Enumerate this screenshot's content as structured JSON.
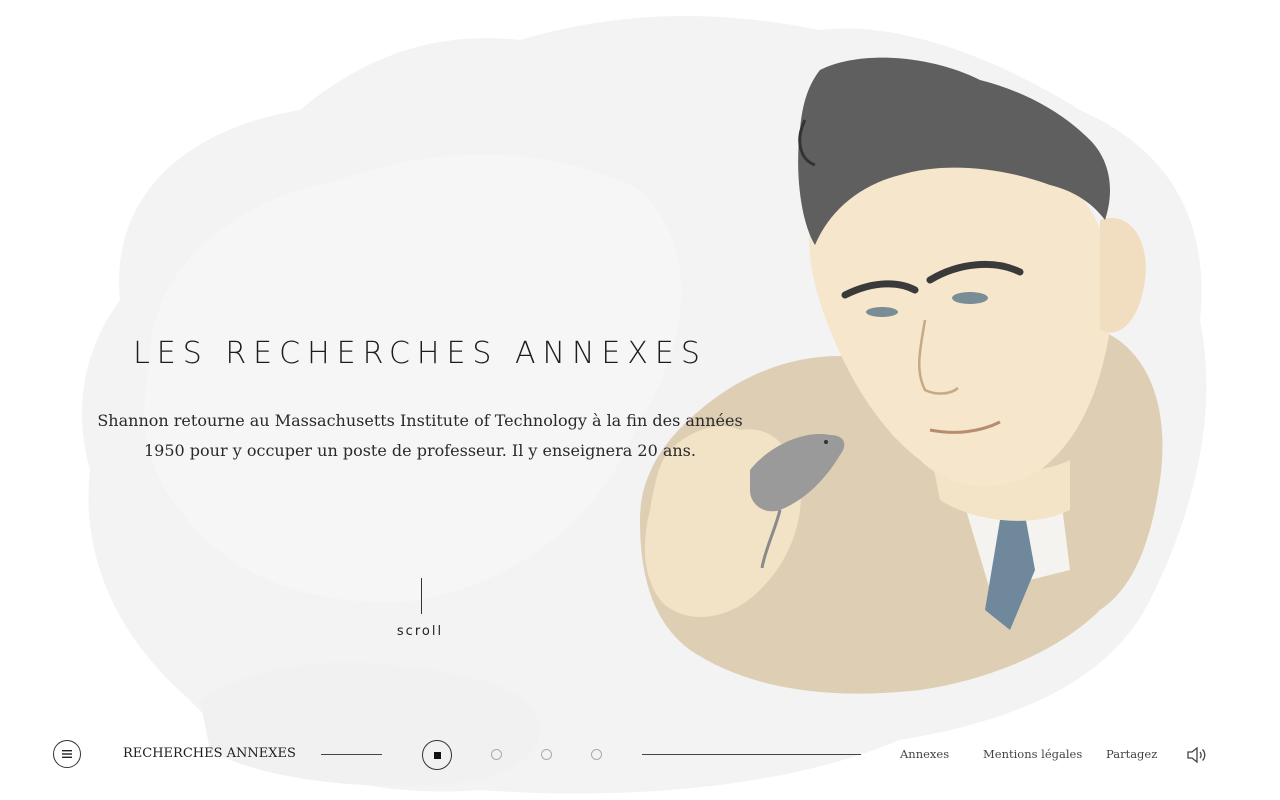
{
  "hero": {
    "title": "LES RECHERCHES ANNEXES",
    "text": "Shannon retourne au Massachusetts Institute of Technology à la fin des années 1950 pour y occuper un poste de professeur. Il y enseignera 20 ans.",
    "scroll_label": "scroll"
  },
  "portrait": {
    "subject": "illustrated portrait of a man holding a mouse"
  },
  "footer": {
    "menu_icon": "menu-icon",
    "section_label": "RECHERCHES ANNEXES",
    "steps": {
      "count": 4,
      "active_index": 0
    },
    "links": [
      {
        "label": "Annexes"
      },
      {
        "label": "Mentions légales"
      },
      {
        "label": "Partagez"
      }
    ],
    "sound_icon": "speaker-icon"
  },
  "colors": {
    "wash": "#f3f3f3",
    "text": "#222222",
    "hair": "#5e5e5e",
    "skin": "#f6e6cb",
    "jacket": "#d8c4a4",
    "tie": "#6e879a",
    "mouse": "#9a9a9a"
  }
}
